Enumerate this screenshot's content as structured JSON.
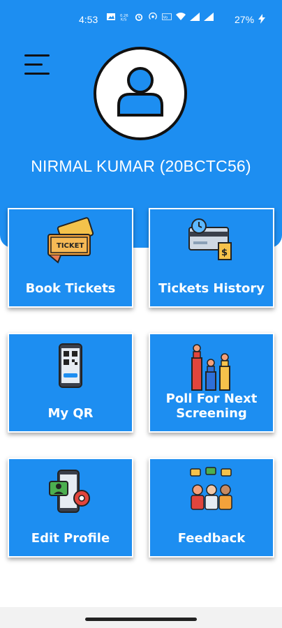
{
  "status_bar": {
    "time": "4:53",
    "battery": "27%",
    "icons": [
      "image-icon",
      "data-speed-icon",
      "alarm-icon",
      "hotspot-icon",
      "volte-icon",
      "wifi-icon",
      "signal-icon",
      "signal-icon",
      "charging-icon"
    ]
  },
  "colors": {
    "primary": "#1d8ef1",
    "text_on_primary": "#ffffff"
  },
  "header": {
    "menu_icon": "hamburger-menu-icon",
    "avatar_icon": "user-avatar-icon",
    "user_name": "NIRMAL KUMAR (20BCTC56)"
  },
  "tiles": [
    {
      "label": "Book Tickets",
      "icon": "ticket-icon"
    },
    {
      "label": "Tickets History",
      "icon": "card-history-icon"
    },
    {
      "label": "My QR",
      "icon": "qr-phone-icon"
    },
    {
      "label": "Poll For Next Screening",
      "icon": "poll-podium-icon"
    },
    {
      "label": "Edit Profile",
      "icon": "profile-settings-icon"
    },
    {
      "label": "Feedback",
      "icon": "feedback-people-icon"
    }
  ]
}
